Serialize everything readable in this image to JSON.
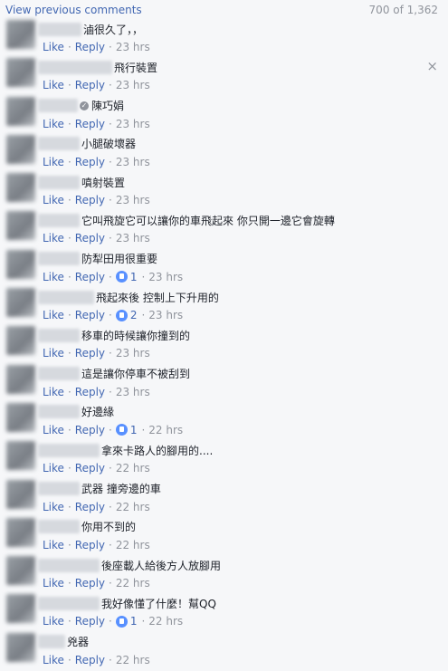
{
  "header": {
    "view_previous": "View previous comments",
    "count": "700 of 1,362"
  },
  "close_icon": "×",
  "labels": {
    "like": "Like",
    "reply": "Reply"
  },
  "comments": [
    {
      "text": "滷很久了，，",
      "likes": null,
      "time": "23 hrs",
      "name_w": 48
    },
    {
      "text": "飛行裝置",
      "likes": null,
      "time": "23 hrs",
      "name_w": 82
    },
    {
      "text": "陳巧娟",
      "likes": null,
      "time": "23 hrs",
      "name_w": 44,
      "verified": true
    },
    {
      "text": "小腿破壞器",
      "likes": null,
      "time": "23 hrs",
      "name_w": 46
    },
    {
      "text": "噴射裝置",
      "likes": null,
      "time": "23 hrs",
      "name_w": 46
    },
    {
      "text": "它叫飛旋它可以讓你的車飛起來 你只開一邊它會旋轉",
      "likes": null,
      "time": "23 hrs",
      "name_w": 46
    },
    {
      "text": "防犁田用很重要",
      "likes": "1",
      "time": "23 hrs",
      "name_w": 46
    },
    {
      "text": "飛起來後 控制上下升用的",
      "likes": "2",
      "time": "23 hrs",
      "name_w": 62
    },
    {
      "text": "移車的時候讓你撞到的",
      "likes": null,
      "time": "23 hrs",
      "name_w": 46
    },
    {
      "text": "這是讓你停車不被刮到",
      "likes": null,
      "time": "23 hrs",
      "name_w": 46
    },
    {
      "text": "好邊緣",
      "likes": "1",
      "time": "22 hrs",
      "name_w": 46
    },
    {
      "text": "拿來卡路人的腳用的....",
      "likes": null,
      "time": "22 hrs",
      "name_w": 68
    },
    {
      "text": "武器 撞旁邊的車",
      "likes": null,
      "time": "22 hrs",
      "name_w": 46
    },
    {
      "text": "你用不到的",
      "likes": null,
      "time": "22 hrs",
      "name_w": 46
    },
    {
      "text": "後座載人給後方人放腳用",
      "likes": null,
      "time": "22 hrs",
      "name_w": 68
    },
    {
      "text": "我好像懂了什麼！幫QQ",
      "likes": "1",
      "time": "22 hrs",
      "name_w": 68
    },
    {
      "text": "兇器",
      "likes": null,
      "time": "22 hrs",
      "name_w": 30
    }
  ]
}
